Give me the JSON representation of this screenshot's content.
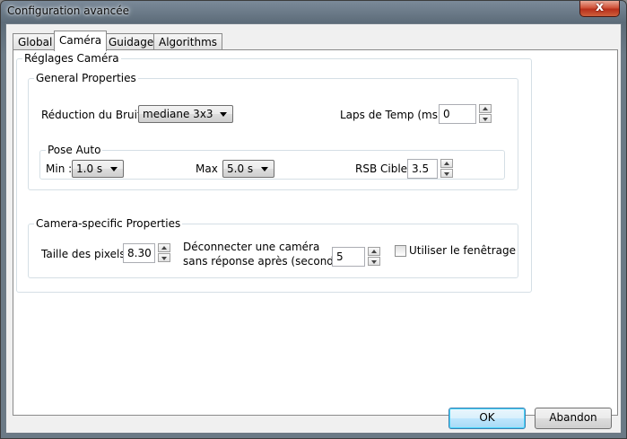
{
  "window": {
    "title": "Configuration avancée",
    "close_glyph": "x"
  },
  "tabs": [
    {
      "label": "Global",
      "active": false
    },
    {
      "label": "Caméra",
      "active": true
    },
    {
      "label": "Guidage",
      "active": false
    },
    {
      "label": "Algorithms",
      "active": false
    }
  ],
  "camera_settings": {
    "legend": "Réglages Caméra",
    "general": {
      "legend": "General Properties",
      "noise_reduction_label": "Réduction du Bruit :",
      "noise_reduction_value": "mediane 3x3",
      "time_lapse_label": "Laps de Temp (ms) :",
      "time_lapse_value": "0",
      "auto_exposure": {
        "legend": "Pose Auto",
        "min_label": "Min :",
        "min_value": "1.0 s",
        "max_label": "Max :",
        "max_value": "5.0 s",
        "snr_target_label": "RSB Cible :",
        "snr_target_value": "3.5"
      }
    },
    "specific": {
      "legend": "Camera-specific Properties",
      "pixel_size_label": "Taille des pixels :",
      "pixel_size_value": "8.30",
      "disconnect_label_line1": "Déconnecter une caméra",
      "disconnect_label_line2": "sans réponse après  (seconds) :",
      "disconnect_value": "5",
      "subframes_label": "Utiliser le fenêtrage",
      "subframes_checked": false
    }
  },
  "buttons": {
    "ok": "OK",
    "cancel": "Abandon"
  },
  "icons": {
    "close": "close-icon",
    "dropdown": "chevron-down-icon",
    "spin_up": "arrow-up-icon",
    "spin_down": "arrow-down-icon"
  }
}
